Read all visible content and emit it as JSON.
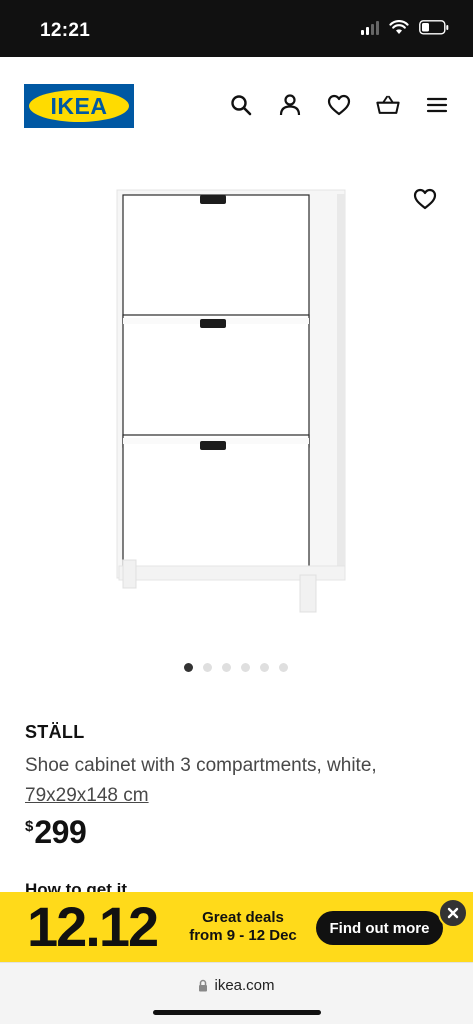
{
  "status_bar": {
    "time": "12:21"
  },
  "header": {
    "logo_text": "IKEA",
    "icons": [
      "search-icon",
      "account-icon",
      "heart-icon",
      "basket-icon",
      "menu-icon"
    ]
  },
  "gallery": {
    "dot_count": 6,
    "active_index": 0
  },
  "product": {
    "name": "STÄLL",
    "description": "Shoe cabinet with 3 compartments, white,",
    "dimensions": "79x29x148 cm",
    "price_currency": "$",
    "price_amount": "299",
    "how_to_get": "How to get it"
  },
  "promo": {
    "date_big": "12.12",
    "line1": "Great deals",
    "line2": "from 9 - 12 Dec",
    "button": "Find out more"
  },
  "browser": {
    "url": "ikea.com"
  },
  "colors": {
    "brand_blue": "#0058a3",
    "brand_yellow": "#ffdb00",
    "promo_yellow": "#ffda1a"
  }
}
